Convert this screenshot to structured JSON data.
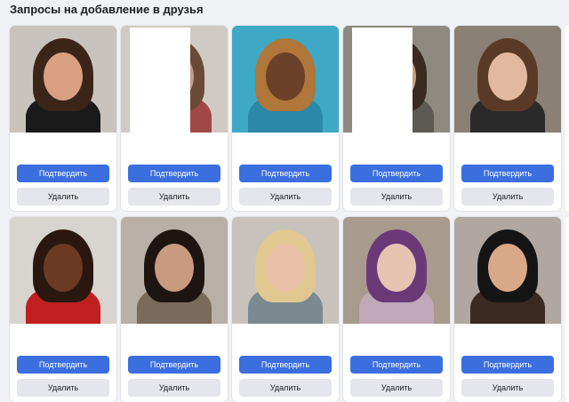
{
  "section": {
    "title": "Запросы на добавление в друзья"
  },
  "requests": [
    {
      "confirm_label": "Подтвердить",
      "delete_label": "Удалить",
      "photo": {
        "bg": "#c9c3bd",
        "hair": "#3b2418",
        "skin": "#d9a084",
        "top": "#1a1a1a",
        "censored": false
      }
    },
    {
      "confirm_label": "Подтвердить",
      "delete_label": "Удалить",
      "photo": {
        "bg": "#cfcac4",
        "hair": "#6a4a35",
        "skin": "#c79a86",
        "top": "#a04848",
        "censored": true
      }
    },
    {
      "confirm_label": "Подтвердить",
      "delete_label": "Удалить",
      "photo": {
        "bg": "#3fa8c4",
        "hair": "#b0763a",
        "skin": "#6b4127",
        "top": "#2a88a8",
        "censored": false
      }
    },
    {
      "confirm_label": "Подтвердить",
      "delete_label": "Удалить",
      "photo": {
        "bg": "#8e8a80",
        "hair": "#3a2a20",
        "skin": "#c9a080",
        "top": "#5a5a50",
        "censored": true
      }
    },
    {
      "confirm_label": "Подтвердить",
      "delete_label": "Удалить",
      "photo": {
        "bg": "#8a8076",
        "hair": "#5a3a26",
        "skin": "#e2b9a0",
        "top": "#2a2a2a",
        "censored": false
      }
    },
    {
      "confirm_label": "Подтвердить",
      "delete_label": "Удалить",
      "photo": {
        "bg": "#d8d4d0",
        "hair": "#2a1810",
        "skin": "#6b3a22",
        "top": "#c02020",
        "censored": false
      }
    },
    {
      "confirm_label": "Подтвердить",
      "delete_label": "Удалить",
      "photo": {
        "bg": "#b8b0a6",
        "hair": "#1e1410",
        "skin": "#c89a80",
        "top": "#7a6a5a",
        "censored": false
      }
    },
    {
      "confirm_label": "Подтвердить",
      "delete_label": "Удалить",
      "photo": {
        "bg": "#c8c2bc",
        "hair": "#e0c890",
        "skin": "#e8c0a8",
        "top": "#7a8a90",
        "censored": false
      }
    },
    {
      "confirm_label": "Подтвердить",
      "delete_label": "Удалить",
      "photo": {
        "bg": "#a89a8c",
        "hair": "#6a3a78",
        "skin": "#e6c4b2",
        "top": "#c0a8b8",
        "censored": false
      }
    },
    {
      "confirm_label": "Подтвердить",
      "delete_label": "Удалить",
      "photo": {
        "bg": "#b0a8a0",
        "hair": "#141414",
        "skin": "#d8a888",
        "top": "#3a2a22",
        "censored": false
      }
    }
  ]
}
